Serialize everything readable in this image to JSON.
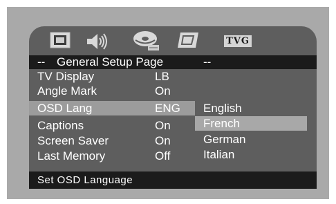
{
  "icons": {
    "general": "monitor-icon",
    "audio": "speaker-icon",
    "video": "disc-icon",
    "preference": "card-icon",
    "tvg_label": "TVG"
  },
  "header": {
    "lead": "--",
    "title": "General Setup Page",
    "tail": "--"
  },
  "menu": {
    "items": [
      {
        "label": "TV Display",
        "value": "LB"
      },
      {
        "label": "Angle Mark",
        "value": "On"
      },
      {
        "label": "OSD Lang",
        "value": "ENG"
      },
      {
        "label": "Captions",
        "value": "On"
      },
      {
        "label": "Screen Saver",
        "value": "On"
      },
      {
        "label": "Last Memory",
        "value": "Off"
      }
    ],
    "selected_index": 2
  },
  "osd_options": {
    "items": [
      "English",
      "French",
      "German",
      "Italian"
    ],
    "highlighted": "French"
  },
  "footer": {
    "hint": "Set OSD Language"
  },
  "colors": {
    "screen_bg": "#5e5e5e",
    "bar_bg": "#1b1b1b",
    "selection": "#9c9c9c",
    "highlight": "#a8a8a8",
    "bezel": "#a9a9a9"
  }
}
